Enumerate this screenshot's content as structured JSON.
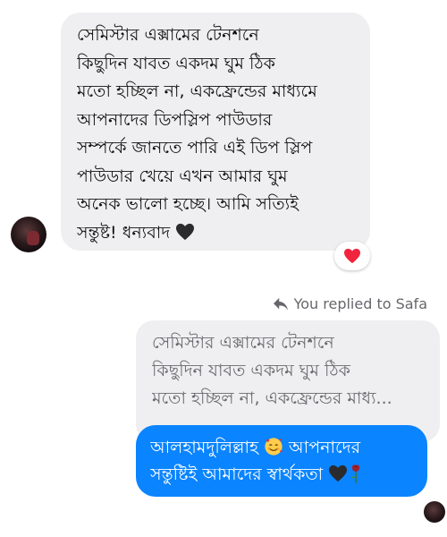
{
  "incoming_message": {
    "lines": [
      "সেমিস্টার এক্সামের টেনশনে",
      "কিছুদিন যাবত একদম ঘুম ঠিক",
      "মতো হচ্ছিল না, একফ্রেন্ডের মাধ্যমে",
      "আপনাদের ডিপস্লিপ পাউডার",
      "সম্পর্কে জানতে পারি এই ডিপ স্লিপ",
      "পাউডার খেয়ে এখন আমার ঘুম",
      "অনেক ভালো হচ্ছে। আমি সত্যিই",
      "সন্তুষ্ট! ধন্যবাদ"
    ],
    "end_emoji": "black-heart-icon",
    "reaction": "red-heart-icon"
  },
  "reply_indicator": {
    "text": "You replied to Safa",
    "icon": "reply-arrow-icon"
  },
  "quoted_message": {
    "lines": [
      "সেমিস্টার এক্সামের টেনশনে",
      "কিছুদিন যাবত একদম ঘুম ঠিক",
      "মতো হচ্ছিল না, একফ্রেন্ডের মাধ্য..."
    ]
  },
  "outgoing_message": {
    "line1_before": "আলহামদুলিল্লাহ",
    "line1_after": " আপনাদের",
    "line2": "সন্তুষ্টিই আমাদের স্বার্থকতা ",
    "emojis": [
      "smiling-face-with-hearts-icon",
      "black-heart-icon",
      "wilted-rose-icon"
    ]
  },
  "colors": {
    "outgoing_bubble": "#0a84ff",
    "incoming_bubble": "#efeff1",
    "secondary_text": "#65676b"
  }
}
